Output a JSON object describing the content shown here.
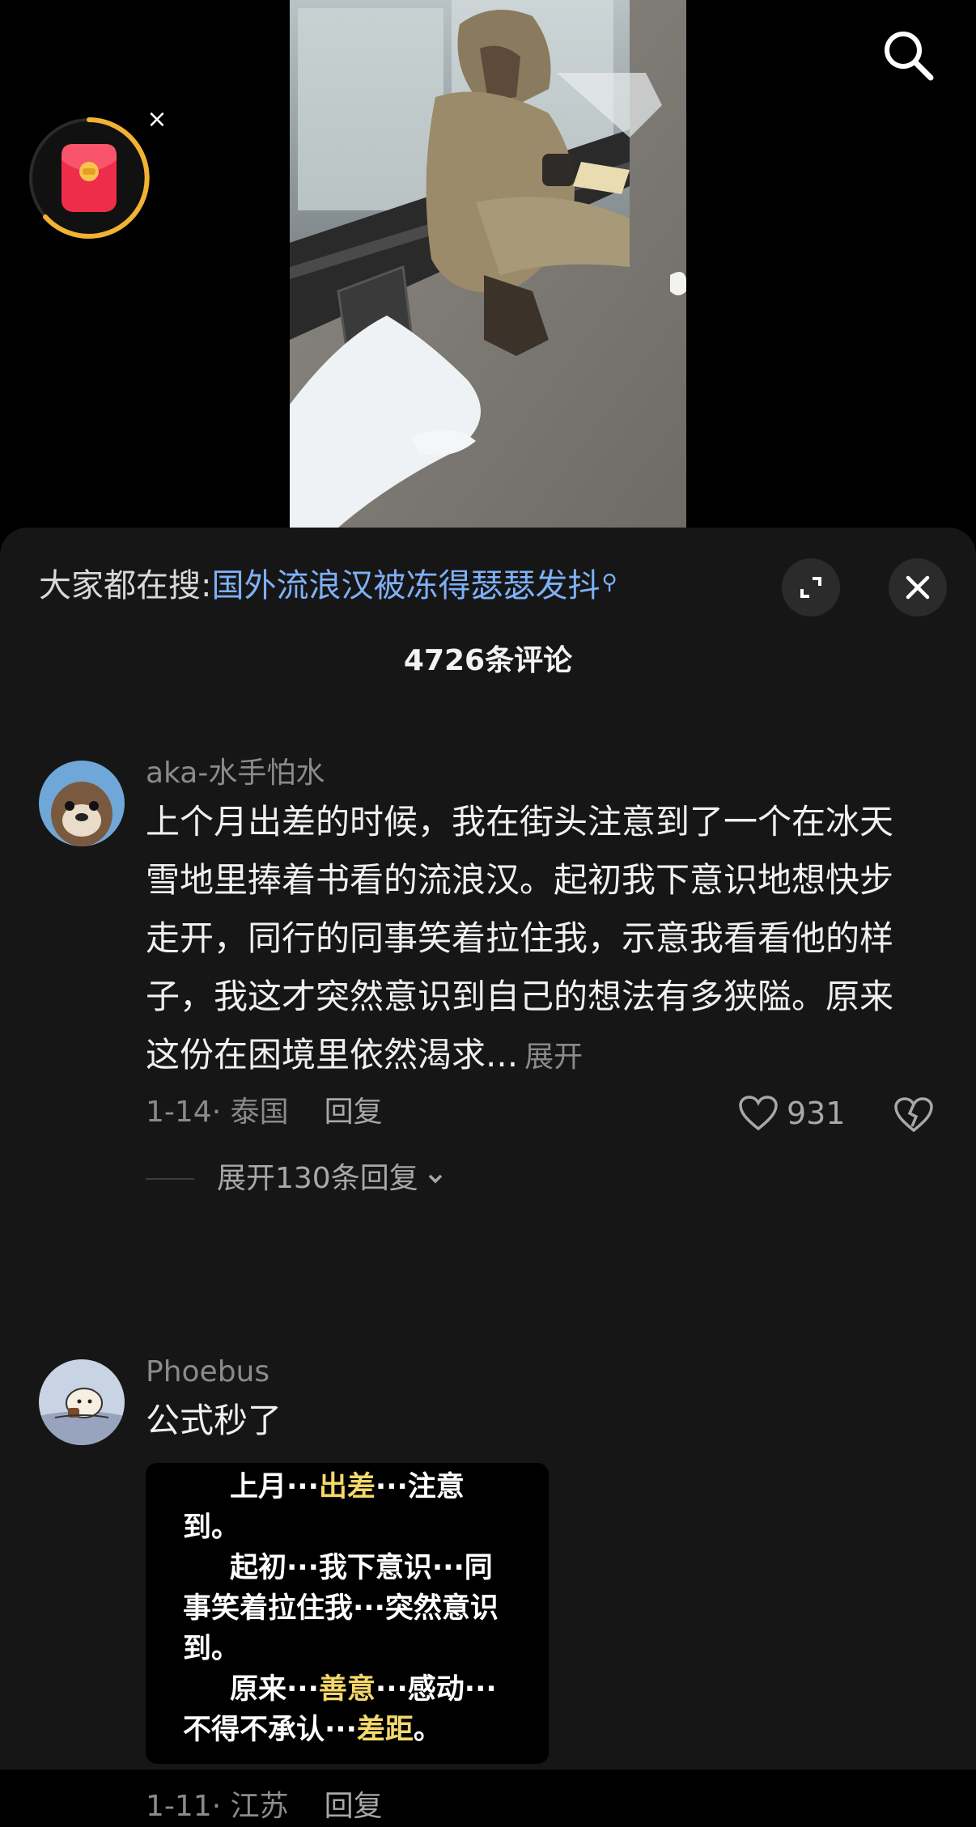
{
  "hot_search": {
    "label": "大家都在搜:",
    "query": "国外流浪汉被冻得瑟瑟发抖"
  },
  "comment_count": "4726条评论",
  "icons": {
    "top_search": "search-icon",
    "red_packet": "red-packet-icon",
    "red_packet_close": "close-icon",
    "expand": "expand-icon",
    "close": "close-icon",
    "like": "heart-icon",
    "dislike": "broken-heart-icon",
    "chevron": "chevron-down-icon"
  },
  "colors": {
    "accent_link": "#7fb0f5",
    "highlight": "#f4d86a",
    "sheet_bg": "#161616"
  },
  "comments": [
    {
      "username": "aka-水手怕水",
      "lines": [
        "上个月出差的时候，我在街头注意到了一个在冰天",
        "雪地里捧着书看的流浪汉。起初我下意识地想快步",
        "走开，同行的同事笑着拉住我，示意我看看他的样",
        "子，我这才突然意识到自己的想法有多狭隘。原来",
        "这份在困境里依然渴求..."
      ],
      "more": "展开",
      "date": "1-14",
      "location": "· 泰国",
      "reply": "回复",
      "likes": "931",
      "expand_replies": "展开130条回复"
    },
    {
      "username": "Phoebus",
      "text": "公式秒了",
      "sticker": {
        "l1a": "上月···",
        "l1b": "出差",
        "l1c": "···注意",
        "l2": "到。",
        "l3": "起初···我下意识···同",
        "l4": "事笑着拉住我···突然意识",
        "l5": "到。",
        "l6a": "原来···",
        "l6b": "善意",
        "l6c": "···感动···",
        "l7a": "不得不承认···",
        "l7b": "差距",
        "l7c": "。"
      },
      "date": "1-11",
      "location": "· 江苏",
      "reply": "回复"
    }
  ]
}
